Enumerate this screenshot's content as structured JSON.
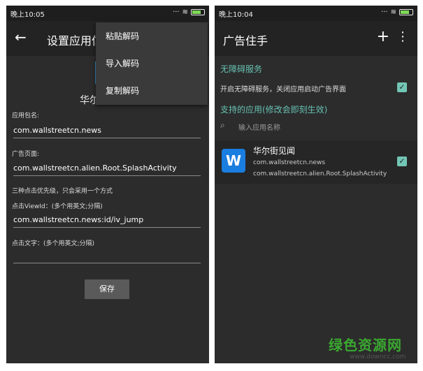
{
  "left": {
    "status_time": "晚上10:05",
    "title": "设置应用信",
    "app_name_partial": "华尔",
    "pkg_label": "应用包名:",
    "pkg_value": "com.wallstreetcn.news",
    "ad_page_label": "广告页面:",
    "ad_page_value": "com.wallstreetcn.alien.Root.SplashActivity",
    "priority_note": "三种点击优先级，只会采用一个方式",
    "viewid_label": "点击ViewId：(多个用英文;分隔)",
    "viewid_value": "com.wallstreetcn.news:id/iv_jump",
    "text_label": "点击文字：(多个用英文;分隔)",
    "text_value": "",
    "save_label": "保存",
    "menu": [
      "粘贴解码",
      "导入解码",
      "复制解码"
    ]
  },
  "right": {
    "status_time": "晚上10:04",
    "title": "广告住手",
    "accessibility_header": "无障碍服务",
    "accessibility_text": "开启无障碍服务，关闭应用启动广告界面",
    "supported_header": "支持的应用(修改会即刻生效)",
    "search_placeholder": "输入应用名称",
    "apps": [
      {
        "name": "华尔街见闻",
        "pkg": "com.wallstreetcn.news",
        "activity": "com.wallstreetcn.alien.Root.SplashActivity",
        "checked": true
      }
    ]
  },
  "watermark": {
    "text": "绿色资源网",
    "url": "www.downcc.com"
  },
  "colors": {
    "accent_teal": "#73c6b6",
    "section_teal": "#66c0b0",
    "app_icon_blue": "#1a7de0",
    "watermark_green": "#3aa830"
  }
}
